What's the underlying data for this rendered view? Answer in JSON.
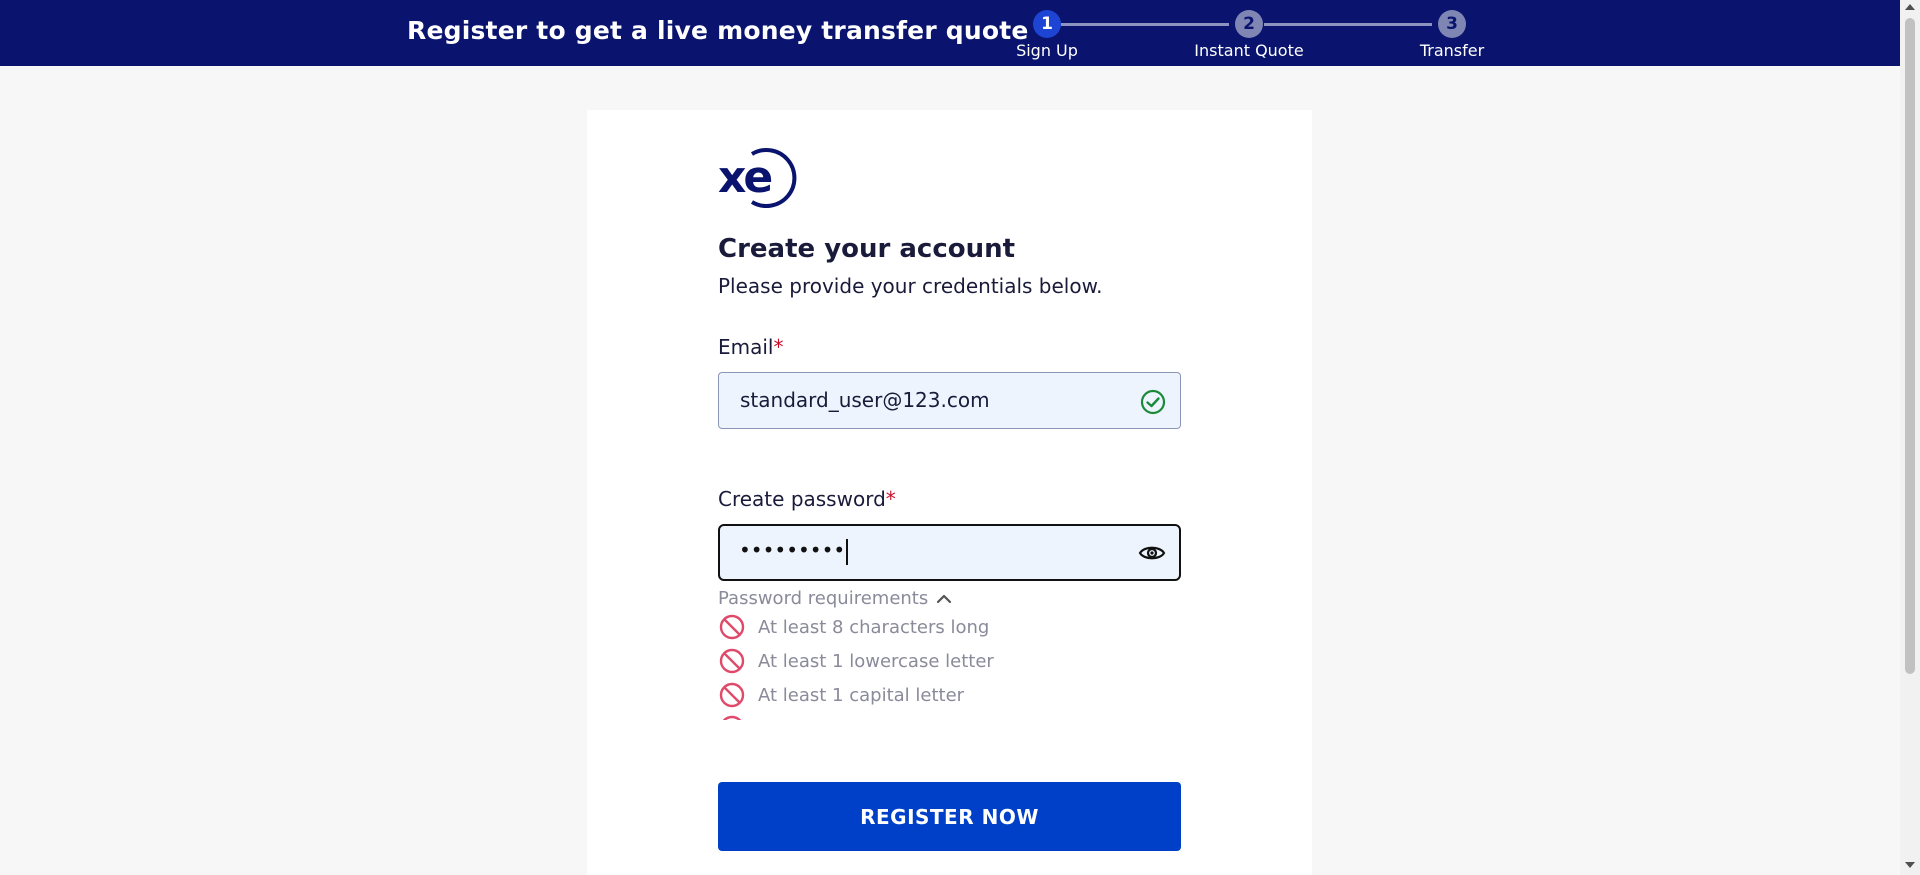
{
  "header": {
    "title": "Register to get a live money transfer quote",
    "steps": [
      {
        "number": "1",
        "label": "Sign Up",
        "state": "active"
      },
      {
        "number": "2",
        "label": "Instant Quote",
        "state": "inactive"
      },
      {
        "number": "3",
        "label": "Transfer",
        "state": "inactive"
      }
    ]
  },
  "brand": {
    "logo_text": "xe",
    "logo_icon": "xe-logo"
  },
  "form": {
    "title": "Create your account",
    "subtitle": "Please provide your credentials below.",
    "email": {
      "label": "Email",
      "required_mark": "*",
      "value": "standard_user@123.com",
      "status_icon": "check-circle-icon"
    },
    "password": {
      "label": "Create password",
      "required_mark": "*",
      "masked_value": "•••••••••",
      "toggle_icon": "eye-icon"
    },
    "requirements": {
      "toggle_label": "Password requirements",
      "toggle_icon": "chevron-up-icon",
      "items": [
        {
          "text": "At least 8 characters long",
          "status": "unmet"
        },
        {
          "text": "At least 1 lowercase letter",
          "status": "unmet"
        },
        {
          "text": "At least 1 capital letter",
          "status": "unmet"
        }
      ]
    },
    "submit_label": "REGISTER NOW"
  },
  "colors": {
    "header_bg": "#0a146e",
    "accent": "#0040c8",
    "step_active": "#1e44d3",
    "required": "#c8102e",
    "valid": "#1a8a3a",
    "invalid": "#e04a6a"
  }
}
